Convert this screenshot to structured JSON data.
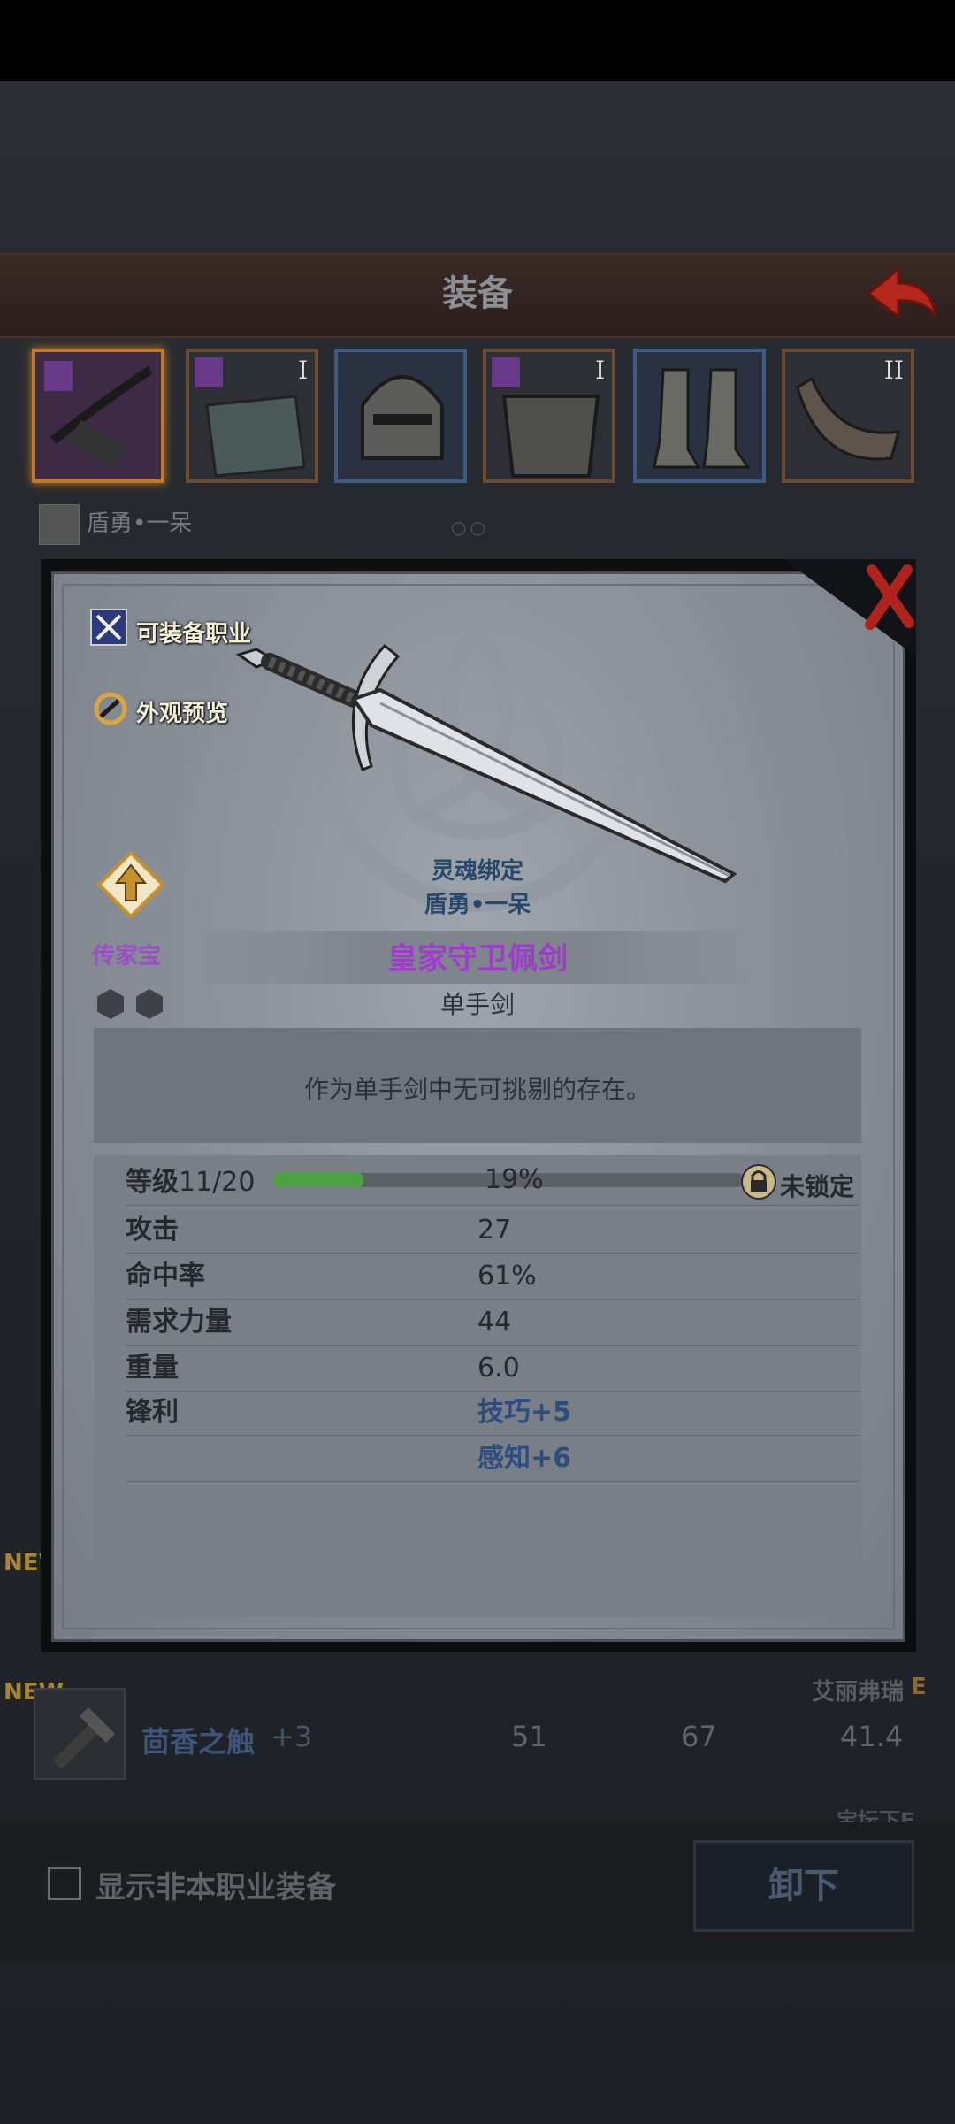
{
  "header": {
    "title": "装备"
  },
  "equipment_slots": [
    {
      "id": "weapon",
      "tier": "",
      "selected": true
    },
    {
      "id": "armor",
      "tier": "I",
      "selected": false
    },
    {
      "id": "helmet",
      "tier": "",
      "selected": false
    },
    {
      "id": "chest",
      "tier": "I",
      "selected": false
    },
    {
      "id": "boots",
      "tier": "",
      "selected": false
    },
    {
      "id": "accessory",
      "tier": "II",
      "selected": false
    }
  ],
  "character": {
    "name": "盾勇•一呆"
  },
  "modal": {
    "links": {
      "equippable_classes": "可装备职业",
      "appearance_preview": "外观预览"
    },
    "soul_bound": "灵魂绑定",
    "bound_to": "盾勇•一呆",
    "heirloom_label": "传家宝",
    "item_name": "皇家守卫佩剑",
    "item_type": "单手剑",
    "description": "作为单手剑中无可挑剔的存在。",
    "level": {
      "label": "等级",
      "value": "11/20",
      "progress_percent": 19,
      "progress_text": "19%",
      "lock_status": "未锁定"
    },
    "stats": [
      {
        "label": "攻击",
        "value": "27"
      },
      {
        "label": "命中率",
        "value": "61%"
      },
      {
        "label": "需求力量",
        "value": "44"
      },
      {
        "label": "重量",
        "value": "6.0"
      },
      {
        "label": "锋利",
        "value": "技巧+5"
      },
      {
        "label": "",
        "value": "感知+6"
      }
    ]
  },
  "list": {
    "new_tag": "NEW",
    "row_item": {
      "name": "茴香之触",
      "plus": "+3",
      "col1": "51",
      "col2": "67",
      "col3": "41.4",
      "owner": "艾丽弗瑞",
      "grade": "E"
    },
    "partial_rows": [
      "宝坛下E"
    ]
  },
  "bottom": {
    "show_other_class": "显示非本职业装备",
    "unequip_button": "卸下"
  },
  "colors": {
    "accent_purple": "#a03ad0",
    "progress_green": "#4ba23e",
    "background": "#1f2227"
  }
}
